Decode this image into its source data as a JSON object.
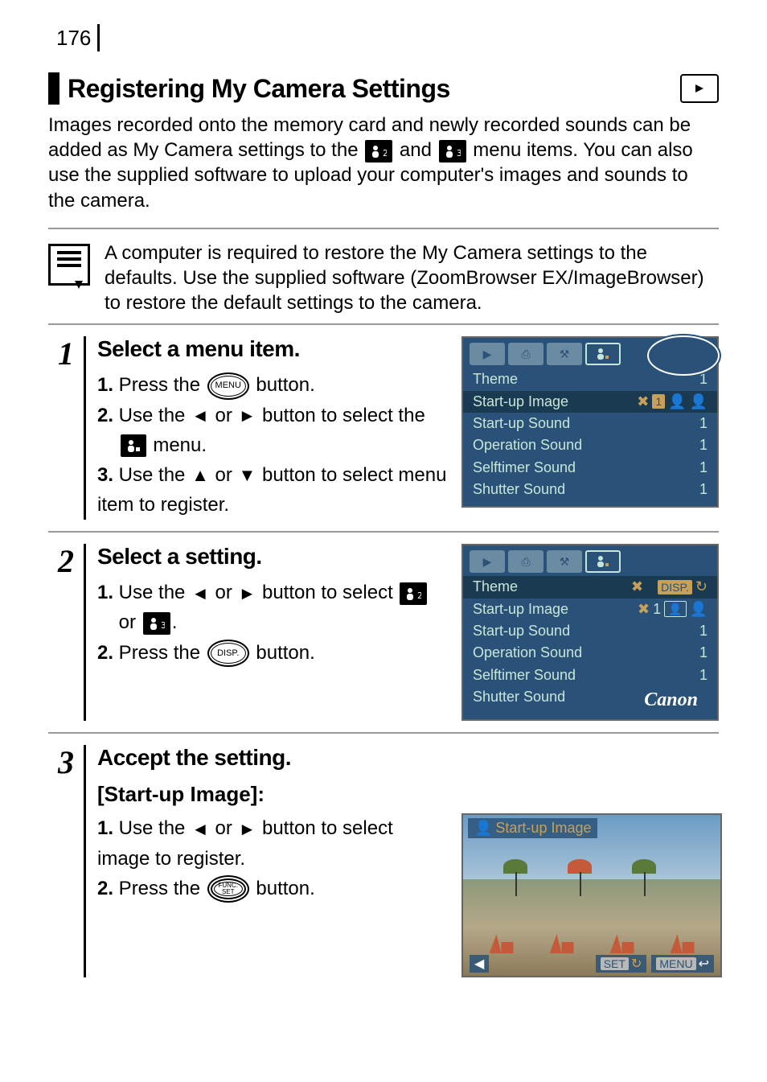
{
  "page_number": "176",
  "title": "Registering My Camera Settings",
  "intro_part1": "Images recorded onto the memory card and newly recorded sounds can be added as My Camera settings to the ",
  "intro_and": " and ",
  "intro_part2": " menu items. You can also use the supplied software to upload your computer's images and sounds to the camera.",
  "note": "A computer is required to restore the My Camera settings to the defaults. Use the supplied software (ZoomBrowser EX/ImageBrowser) to restore the default settings to the camera.",
  "step1": {
    "heading": "Select a menu item.",
    "l1a": "1.",
    "l1b_pre": " Press the ",
    "l1b_post": " button.",
    "menu_btn": "MENU",
    "l2a": "2.",
    "l2b_pre": " Use the ",
    "l2b_mid": " or ",
    "l2b_post": " button to select the ",
    "l2c": " menu.",
    "l3a": "3.",
    "l3b_pre": " Use the ",
    "l3b_mid": " or ",
    "l3b_post": " button to select menu item to register."
  },
  "screen1": {
    "rows": [
      {
        "label": "Theme",
        "val": "1"
      },
      {
        "label": "Start-up Image",
        "val": "1",
        "sel": true,
        "chips": true
      },
      {
        "label": "Start-up Sound",
        "val": "1"
      },
      {
        "label": "Operation Sound",
        "val": "1"
      },
      {
        "label": "Selftimer Sound",
        "val": "1"
      },
      {
        "label": "Shutter Sound",
        "val": "1"
      }
    ]
  },
  "step2": {
    "heading": "Select a setting.",
    "l1a": "1.",
    "l1b_pre": " Use the ",
    "l1b_mid": " or ",
    "l1b_post": " button to select ",
    "l1c": "or ",
    "l1d": ".",
    "l2a": "2.",
    "l2b_pre": " Press the ",
    "l2b_post": " button.",
    "disp_btn": "DISP."
  },
  "screen2": {
    "rows": [
      {
        "label": "Theme",
        "disp": true,
        "sel": true
      },
      {
        "label": "Start-up Image",
        "val": "1",
        "chips": true
      },
      {
        "label": "Start-up Sound",
        "val": "1"
      },
      {
        "label": "Operation Sound",
        "val": "1"
      },
      {
        "label": "Selftimer Sound",
        "val": "1"
      },
      {
        "label": "Shutter Sound",
        "canon": true
      }
    ]
  },
  "step3": {
    "heading": "Accept the setting.",
    "sub": "[Start-up Image]:",
    "l1a": "1.",
    "l1b_pre": " Use the ",
    "l1b_mid": " or ",
    "l1b_post": " button to select image to register.",
    "l2a": "2.",
    "l2b_pre": " Press the ",
    "l2b_post": " button.",
    "func_btn": "FUNC.\nSET"
  },
  "screen3": {
    "title": "Start-up Image",
    "set": "SET",
    "menu": "MENU"
  }
}
